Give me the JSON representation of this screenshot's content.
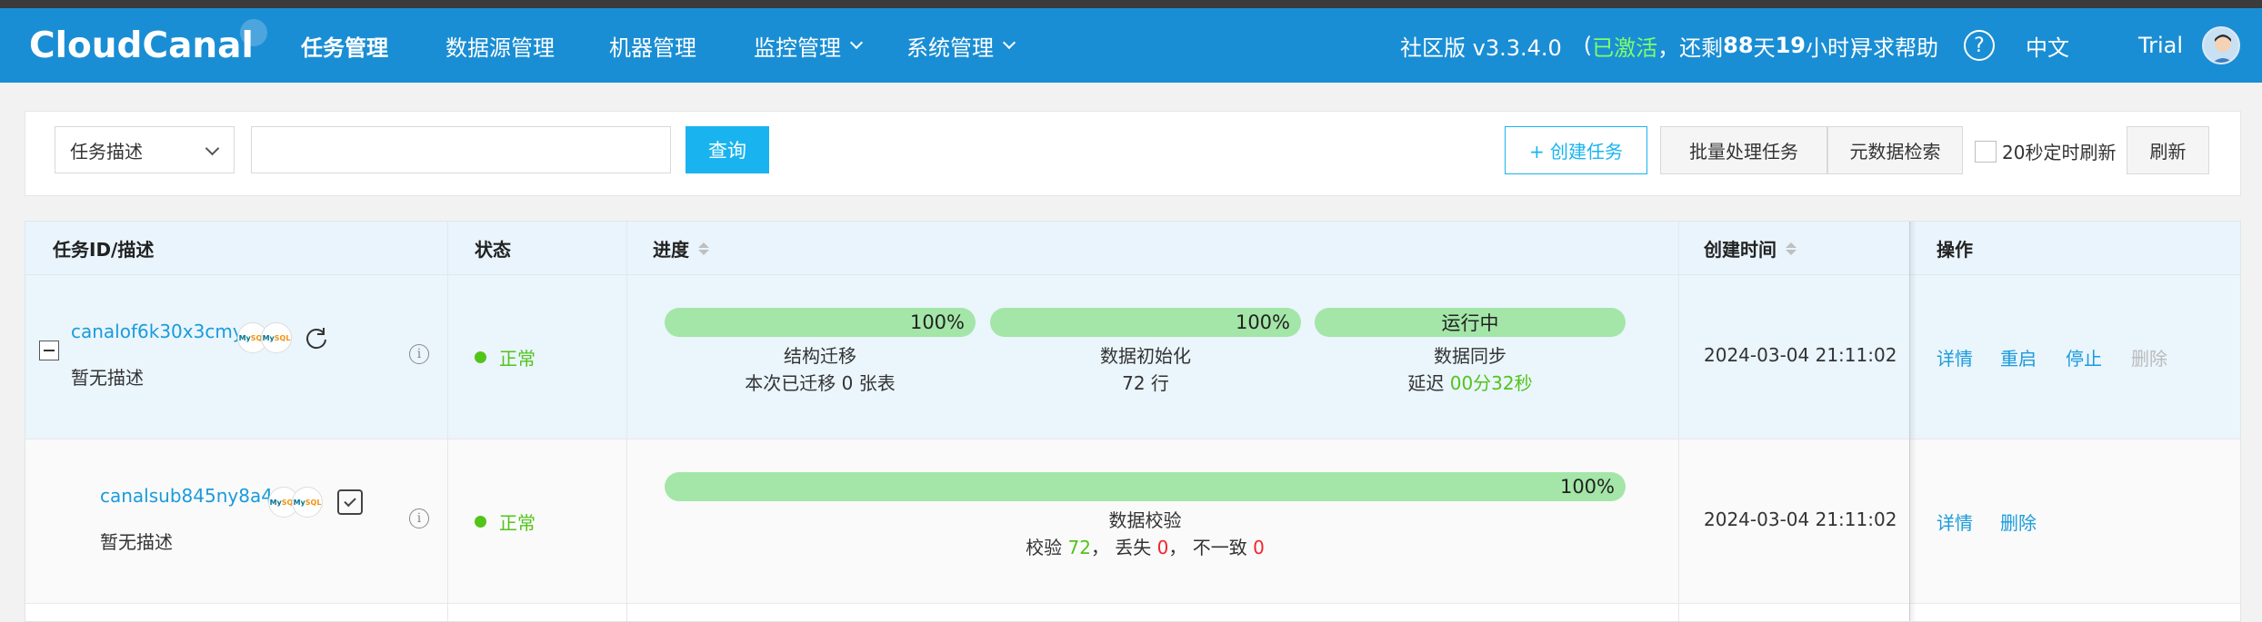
{
  "header": {
    "logo": "CloudCanal",
    "nav": [
      {
        "label": "任务管理",
        "active": true,
        "has_dropdown": false
      },
      {
        "label": "数据源管理",
        "active": false,
        "has_dropdown": false
      },
      {
        "label": "机器管理",
        "active": false,
        "has_dropdown": false
      },
      {
        "label": "监控管理",
        "active": false,
        "has_dropdown": true
      },
      {
        "label": "系统管理",
        "active": false,
        "has_dropdown": true
      }
    ],
    "edition": "社区版 v3.3.4.0",
    "license_open": "(",
    "license_activated": "已激活",
    "license_remaining_prefix": "，还剩",
    "license_days": "88",
    "license_days_unit": "天",
    "license_hours": "19",
    "license_hours_unit": "小时)",
    "help": "寻求帮助",
    "help_icon": "?",
    "language": "中文",
    "user": "Trial"
  },
  "filter": {
    "select_value": "任务描述",
    "input_value": "",
    "query_button": "查询",
    "create_button": "+ 创建任务",
    "batch_button": "批量处理任务",
    "meta_search_button": "元数据检索",
    "auto_refresh_label": "20秒定时刷新",
    "auto_refresh_checked": false,
    "refresh_button": "刷新"
  },
  "table": {
    "columns": [
      "任务ID/描述",
      "状态",
      "进度",
      "创建时间",
      "操作"
    ],
    "rows": [
      {
        "task_id": "canalof6k30x3cmy",
        "description": "暂无描述",
        "status": "正常",
        "source_icon": "MySQL",
        "target_icon": "MySQL",
        "stages": [
          {
            "bar_text": "100%",
            "progress": 1.0,
            "name": "结构迁移",
            "detail": "本次已迁移 0 张表"
          },
          {
            "bar_text": "100%",
            "progress": 1.0,
            "name": "数据初始化",
            "detail": "72 行"
          },
          {
            "bar_text": "运行中",
            "progress": 1.0,
            "name": "数据同步",
            "detail_prefix": "延迟 ",
            "detail_value": "00分32秒"
          }
        ],
        "created": "2024-03-04 21:11:02",
        "actions": [
          "详情",
          "重启",
          "停止",
          "删除"
        ]
      },
      {
        "task_id": "canalsub845ny8a4",
        "description": "暂无描述",
        "status": "正常",
        "source_icon": "MySQL",
        "target_icon": "MySQL",
        "stage": {
          "bar_text": "100%",
          "progress": 1.0,
          "name": "数据校验",
          "check_label": "校验 ",
          "check_value": "72",
          "lost_label": "， 丢失 ",
          "lost_value": "0",
          "diff_label": "， 不一致 ",
          "diff_value": "0"
        },
        "created": "2024-03-04 21:11:02",
        "actions": [
          "详情",
          "删除"
        ]
      }
    ]
  },
  "icons": {
    "info": "i",
    "mysql_a": "My",
    "mysql_b": "SQL"
  },
  "colors": {
    "header_bg": "#1a8ed4",
    "accent": "#19b4ef",
    "status_green": "#52c41a",
    "bar_green": "#a3e6a8",
    "error_red": "#f5222d"
  }
}
